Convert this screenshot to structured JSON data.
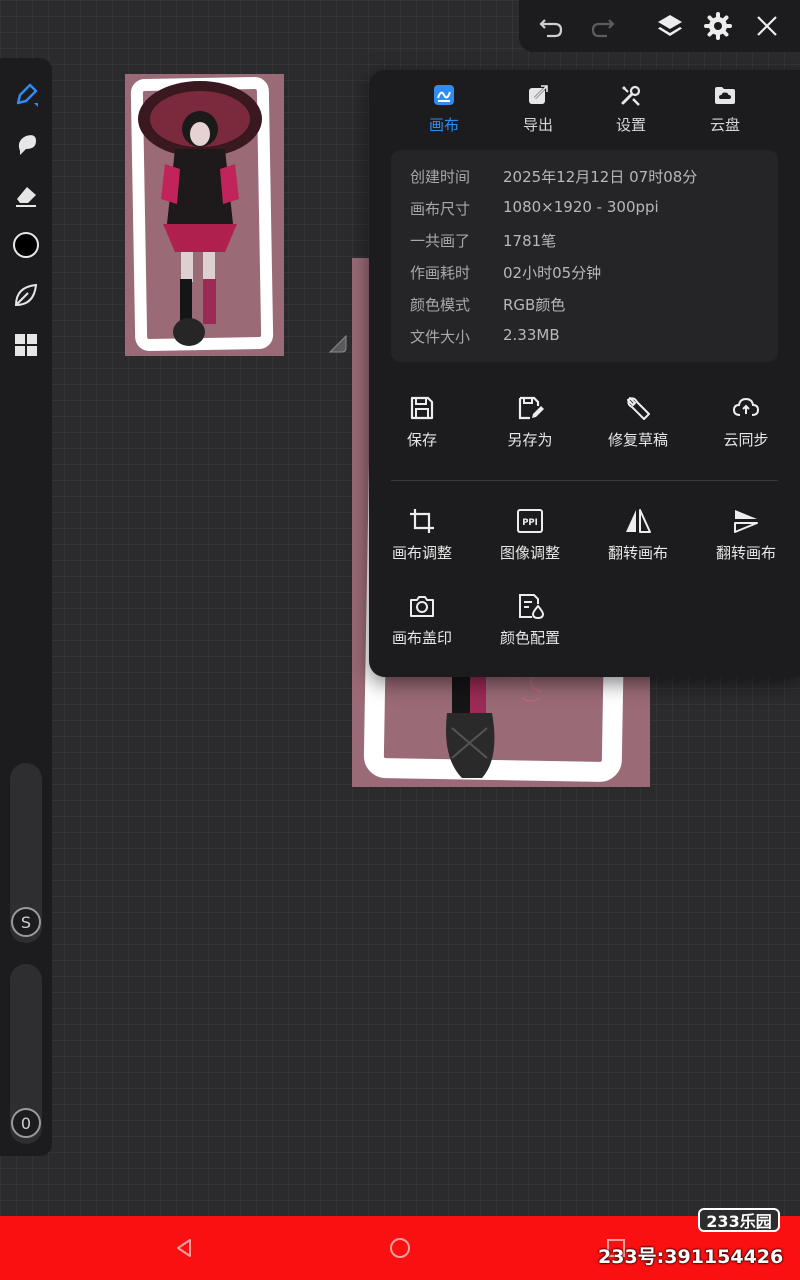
{
  "toolbar": {
    "undo_icon": "undo-icon",
    "redo_icon": "redo-icon",
    "layers_icon": "layers-icon",
    "settings_icon": "gear-icon",
    "close_icon": "close-icon"
  },
  "tools": {
    "items": [
      "pen-tool-icon",
      "smudge-icon",
      "eraser-icon",
      "color-swatch",
      "leaf-icon",
      "grid-icon"
    ],
    "active_color": "#2f8cf3",
    "current_color": "#000000",
    "size_slider_label": "S",
    "opacity_slider_label": "0"
  },
  "popup": {
    "tabs": [
      {
        "label": "画布",
        "icon": "canvas-icon",
        "active": true
      },
      {
        "label": "导出",
        "icon": "export-icon",
        "active": false
      },
      {
        "label": "设置",
        "icon": "settings-icon",
        "active": false
      },
      {
        "label": "云盘",
        "icon": "cloud-drive-icon",
        "active": false
      }
    ],
    "info": [
      {
        "key": "创建时间",
        "value": "2025年12月12日 07时08分"
      },
      {
        "key": "画布尺寸",
        "value": "1080×1920 - 300ppi"
      },
      {
        "key": "一共画了",
        "value": "1781笔"
      },
      {
        "key": "作画耗时",
        "value": "02小时05分钟"
      },
      {
        "key": "颜色模式",
        "value": "RGB颜色"
      },
      {
        "key": "文件大小",
        "value": "2.33MB"
      }
    ],
    "actions_row1": [
      {
        "label": "保存",
        "icon": "save-icon"
      },
      {
        "label": "另存为",
        "icon": "save-as-icon"
      },
      {
        "label": "修复草稿",
        "icon": "wrench-icon"
      },
      {
        "label": "云同步",
        "icon": "cloud-sync-icon"
      }
    ],
    "actions_row2": [
      {
        "label": "画布调整",
        "icon": "crop-icon"
      },
      {
        "label": "图像调整",
        "icon": "ppi-icon",
        "badge": "PPI"
      },
      {
        "label": "翻转画布",
        "icon": "flip-horizontal-icon"
      },
      {
        "label": "翻转画布",
        "icon": "flip-vertical-icon"
      }
    ],
    "actions_row3": [
      {
        "label": "画布盖印",
        "icon": "camera-icon"
      },
      {
        "label": "颜色配置",
        "icon": "color-profile-icon"
      }
    ]
  },
  "navbar": {
    "back_icon": "back-icon",
    "home_icon": "home-icon",
    "recents_icon": "recents-icon",
    "color": "#fa1010"
  },
  "watermark": {
    "logo": "233乐园",
    "id_text": "233号:391154426"
  }
}
